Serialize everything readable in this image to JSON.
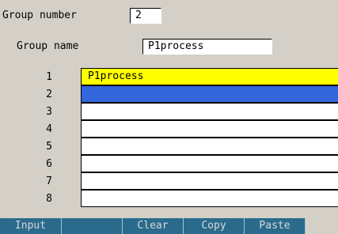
{
  "group_number": {
    "label": "Group number",
    "value": "2"
  },
  "group_name": {
    "label": "Group name",
    "value": "P1process"
  },
  "rows": [
    {
      "num": "1",
      "value": "P1process"
    },
    {
      "num": "2",
      "value": ""
    },
    {
      "num": "3",
      "value": ""
    },
    {
      "num": "4",
      "value": ""
    },
    {
      "num": "5",
      "value": ""
    },
    {
      "num": "6",
      "value": ""
    },
    {
      "num": "7",
      "value": ""
    },
    {
      "num": "8",
      "value": ""
    }
  ],
  "softkeys": [
    "Input",
    "",
    "Clear",
    "Copy",
    "Paste",
    ""
  ],
  "colors": {
    "background": "#d4d0c8",
    "highlight_yellow": "#ffff00",
    "cursor_blue": "#3366dd",
    "softkey_bar": "#2a6b8c"
  }
}
